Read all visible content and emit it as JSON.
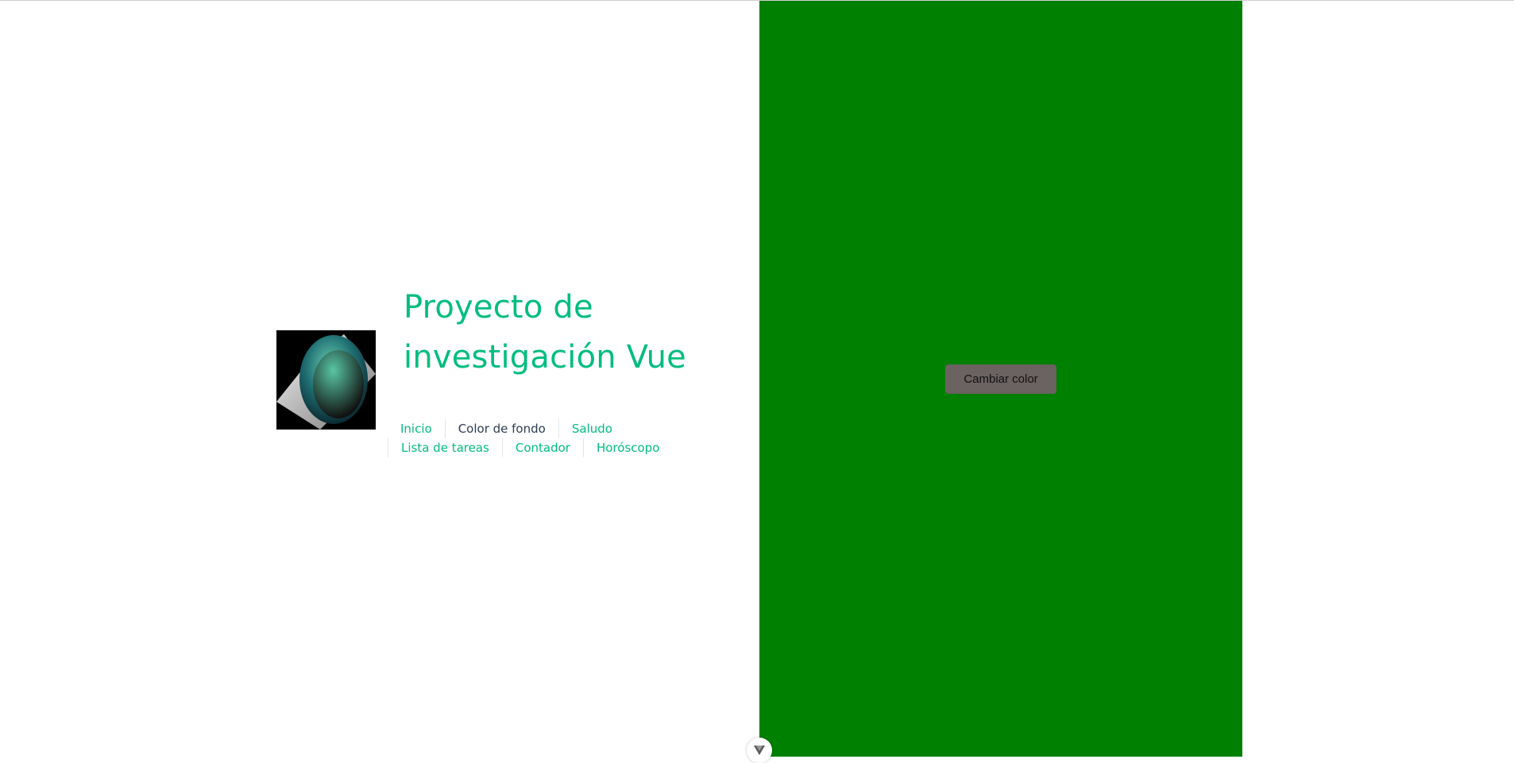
{
  "header": {
    "title": "Proyecto de investigación Vue",
    "logo_icon": "vue-sphere-logo-icon"
  },
  "nav": {
    "row1": [
      {
        "label": "Inicio",
        "active": false
      },
      {
        "label": "Color de fondo",
        "active": true
      },
      {
        "label": "Saludo",
        "active": false
      }
    ],
    "row2": [
      {
        "label": "Lista de tareas",
        "active": false
      },
      {
        "label": "Contador",
        "active": false
      },
      {
        "label": "Horóscopo",
        "active": false
      }
    ]
  },
  "main": {
    "background_color": "#008000",
    "button_label": "Cambiar color"
  },
  "colors": {
    "accent": "#00bd7e",
    "text_dark": "#2c3e50",
    "button_bg": "#6b6262"
  },
  "devtools": {
    "icon": "vue-devtools-chevron-icon"
  }
}
